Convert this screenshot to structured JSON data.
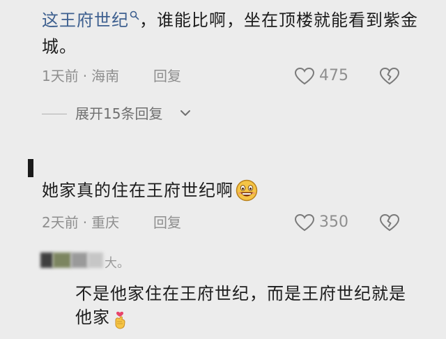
{
  "comments": [
    {
      "text_link": "这王府世纪",
      "text_rest": "，谁能比啊，坐在顶楼就能看到紫金城。",
      "time": "1天前",
      "location": "海南",
      "reply_label": "回复",
      "likes": "475"
    },
    {
      "text": "她家真的住在王府世纪啊",
      "time": "2天前",
      "location": "重庆",
      "reply_label": "回复",
      "likes": "350"
    }
  ],
  "expand": {
    "label": "展开15条回复"
  },
  "reply": {
    "author_visible": "大。",
    "text": "不是他家住在王府世纪，而是王府世纪就是他家"
  },
  "icons": {
    "search": "search-icon",
    "like": "heart-outline-icon",
    "dislike": "broken-heart-icon",
    "expand": "chevron-down-icon",
    "smile": "grinning-face-emoji",
    "hand": "finger-heart-emoji"
  },
  "colors": {
    "background": "#ececec",
    "text": "#1c1c1c",
    "link": "#3d5f8f",
    "meta": "#8e8e8e"
  }
}
